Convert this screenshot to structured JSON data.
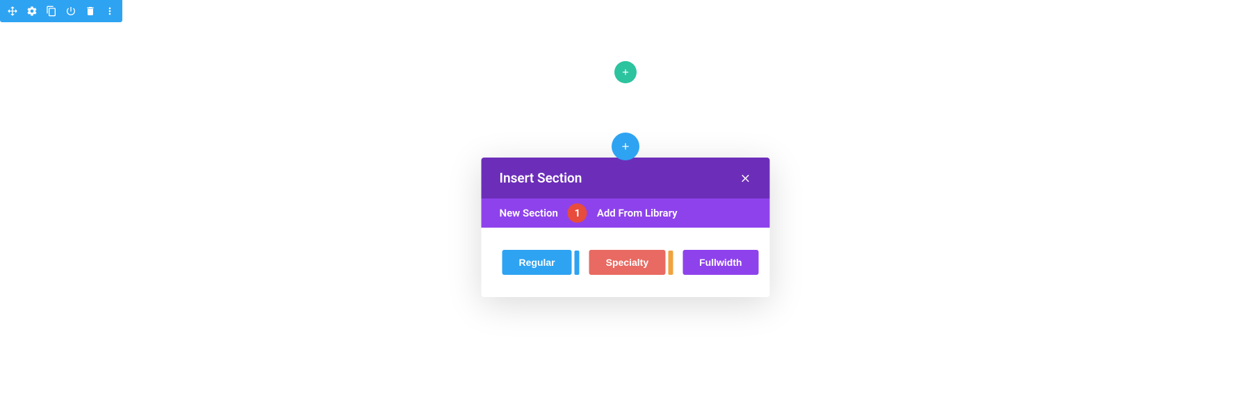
{
  "toolbar": {
    "icons": [
      "move",
      "settings",
      "duplicate",
      "power",
      "delete",
      "more"
    ]
  },
  "modal": {
    "title": "Insert Section",
    "tabs": {
      "new_section": "New Section",
      "badge": "1",
      "add_from_library": "Add From Library"
    },
    "section_types": {
      "regular": "Regular",
      "specialty": "Specialty",
      "fullwidth": "Fullwidth"
    }
  }
}
